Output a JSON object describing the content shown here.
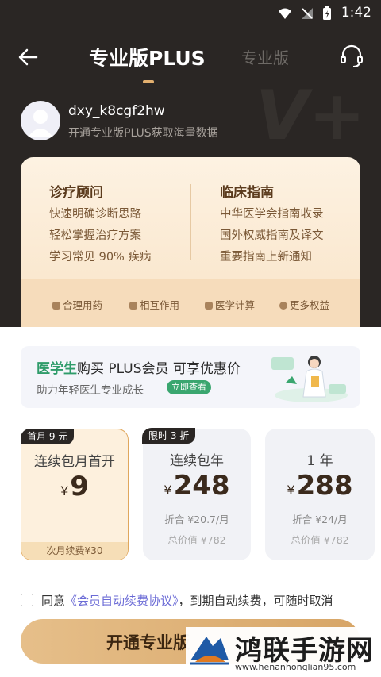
{
  "status": {
    "time": "1:42"
  },
  "nav": {
    "title": "专业版PLUS",
    "alt_tab": "专业版"
  },
  "user": {
    "name": "dxy_k8cgf2hw",
    "desc": "开通专业版PLUS获取海量数据"
  },
  "benefits": {
    "left": {
      "title": "诊疗顾问",
      "items": [
        "快速明确诊断思路",
        "轻松掌握治疗方案",
        "学习常见 90% 疾病"
      ]
    },
    "right": {
      "title": "临床指南",
      "items": [
        "中华医学会指南收录",
        "国外权威指南及译文",
        "重要指南上新通知"
      ]
    },
    "strip": [
      "合理用药",
      "相互作用",
      "医学计算",
      "更多权益"
    ]
  },
  "promo": {
    "highlight": "医学生",
    "title_rest": "购买 PLUS会员 可享优惠价",
    "sub": "助力年轻医生专业成长",
    "button": "立即查看"
  },
  "plans": [
    {
      "tag": "首月 9 元",
      "name": "连续包月首开",
      "currency": "¥",
      "price": "9",
      "foot": "次月续费¥30"
    },
    {
      "tag": "限时 3 折",
      "name": "连续包年",
      "currency": "¥",
      "price": "248",
      "per": "折合 ¥20.7/月",
      "orig": "总价值 ¥782"
    },
    {
      "name": "1 年",
      "currency": "¥",
      "price": "288",
      "per": "折合 ¥24/月",
      "orig": "总价值 ¥782"
    }
  ],
  "agree": {
    "prefix": "同意",
    "link": "《会员自动续费协议》",
    "suffix": "，到期自动续费，可随时取消"
  },
  "cta": {
    "label": "开通专业版"
  },
  "watermark": {
    "title": "鸿联手游网",
    "url": "www.henanhonglian95.com"
  },
  "colors": {
    "header": "#2a2624",
    "accent": "#e3b06f",
    "green": "#3aa66f",
    "link": "#6b6bd6"
  }
}
